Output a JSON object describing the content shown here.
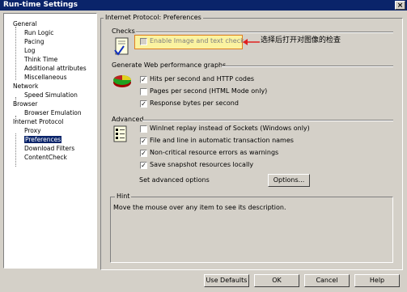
{
  "window": {
    "title": "Run-time Settings",
    "close": "×"
  },
  "tree": {
    "items": [
      {
        "label": "General",
        "level": 0
      },
      {
        "label": "Run Logic",
        "level": 1
      },
      {
        "label": "Pacing",
        "level": 1
      },
      {
        "label": "Log",
        "level": 1
      },
      {
        "label": "Think Time",
        "level": 1
      },
      {
        "label": "Additional attributes",
        "level": 1
      },
      {
        "label": "Miscellaneous",
        "level": 1
      },
      {
        "label": "Network",
        "level": 0
      },
      {
        "label": "Speed Simulation",
        "level": 1
      },
      {
        "label": "Browser",
        "level": 0
      },
      {
        "label": "Browser Emulation",
        "level": 1
      },
      {
        "label": "Internet Protocol",
        "level": 0
      },
      {
        "label": "Proxy",
        "level": 1
      },
      {
        "label": "Preferences",
        "level": 1,
        "selected": true
      },
      {
        "label": "Download Filters",
        "level": 1
      },
      {
        "label": "ContentCheck",
        "level": 1
      }
    ]
  },
  "panel": {
    "title": "Internet Protocol: Preferences",
    "checks": {
      "heading": "Checks",
      "enable_image_text": {
        "label": "Enable Image and text check",
        "checked": false
      },
      "annotation": "选择后打开对图像的检查"
    },
    "perf": {
      "heading": "Generate Web performance graphs",
      "items": [
        {
          "label": "Hits per second and HTTP codes",
          "checked": true
        },
        {
          "label": "Pages per second (HTML Mode only)",
          "checked": false
        },
        {
          "label": "Response bytes per second",
          "checked": true
        }
      ]
    },
    "advanced": {
      "heading": "Advanced",
      "items": [
        {
          "label": "WinInet replay instead of Sockets (Windows only)",
          "checked": false
        },
        {
          "label": "File and line in automatic transaction names",
          "checked": true
        },
        {
          "label": "Non-critical resource errors as warnings",
          "checked": true
        },
        {
          "label": "Save snapshot resources locally",
          "checked": true
        }
      ],
      "set_options_label": "Set advanced options",
      "options_button": "Options..."
    },
    "hint": {
      "heading": "Hint",
      "text": "Move the mouse over any item to see its description."
    }
  },
  "footer": {
    "use_defaults": "Use Defaults",
    "ok": "OK",
    "cancel": "Cancel",
    "help": "Help"
  },
  "colors": {
    "titlebar": "#0a246a",
    "face": "#d4d0c8",
    "highlight_fill": "#fbf3a0",
    "highlight_border": "#e08020",
    "annotation_arrow": "#e02020"
  }
}
